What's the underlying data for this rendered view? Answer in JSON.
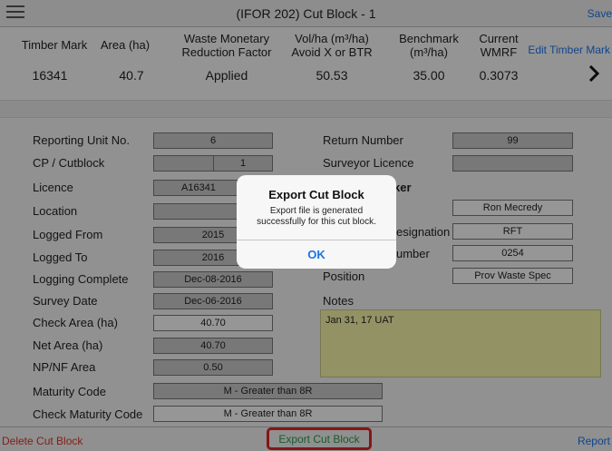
{
  "nav": {
    "title": "(IFOR 202) Cut Block - 1",
    "save_label": "Save"
  },
  "summary": {
    "headers": {
      "timber_mark": "Timber Mark",
      "area": "Area (ha)",
      "wmrf": "Waste Monetary Reduction Factor",
      "vol_ha": "Vol/ha (m³/ha) Avoid X or BTR",
      "benchmark": "Benchmark (m³/ha)",
      "current_wmrf": "Current WMRF"
    },
    "values": {
      "timber_mark": "16341",
      "area": "40.7",
      "wmrf": "Applied",
      "vol_ha": "50.53",
      "benchmark": "35.00",
      "current_wmrf": "0.3073"
    },
    "edit_label": "Edit Timber Mark",
    "chevron": "›"
  },
  "form": {
    "reporting_unit": {
      "label": "Reporting Unit No.",
      "value": "6"
    },
    "cp_cutblock": {
      "label": "CP / Cutblock",
      "cp": "",
      "cutblock": "1"
    },
    "licence": {
      "label": "Licence",
      "value": "A16341"
    },
    "location": {
      "label": "Location",
      "value": ""
    },
    "logged_from": {
      "label": "Logged From",
      "value": "2015"
    },
    "logged_to": {
      "label": "Logged To",
      "value": "2016"
    },
    "logging_complete": {
      "label": "Logging Complete",
      "value": "Dec-08-2016"
    },
    "survey_date": {
      "label": "Survey Date",
      "value": "Dec-06-2016"
    },
    "check_area": {
      "label": "Check Area (ha)",
      "value": "40.70"
    },
    "net_area": {
      "label": "Net Area (ha)",
      "value": "40.70"
    },
    "npnf_area": {
      "label": "NP/NF Area",
      "value": "0.50"
    },
    "maturity_code": {
      "label": "Maturity Code",
      "value": "M - Greater than 8R"
    },
    "check_maturity_code": {
      "label": "Check Maturity Code",
      "value": "M - Greater than 8R"
    },
    "return_number": {
      "label": "Return Number",
      "value": "99"
    },
    "surveyor_licence": {
      "label": "Surveyor Licence",
      "value": ""
    },
    "section_partial": "ker",
    "name_value": "Ron Mecredy",
    "designation": {
      "label_partial": "esignation",
      "value": "RFT"
    },
    "number": {
      "label_partial": "umber",
      "value": "0254"
    },
    "position": {
      "label": "Position",
      "value": "Prov Waste Spec"
    },
    "notes": {
      "label": "Notes",
      "value": "Jan 31, 17 UAT"
    }
  },
  "bottom": {
    "delete_label": "Delete Cut Block",
    "export_label": "Export Cut Block",
    "report_label": "Report"
  },
  "dialog": {
    "title": "Export Cut Block",
    "message": "Export file is generated successfully for this cut block.",
    "ok_label": "OK"
  },
  "colors": {
    "accent": "#1b73e8",
    "danger": "#d9352b",
    "success": "#2b9a45",
    "highlight": "#e02323",
    "notes_bg": "#f4f4a8"
  }
}
